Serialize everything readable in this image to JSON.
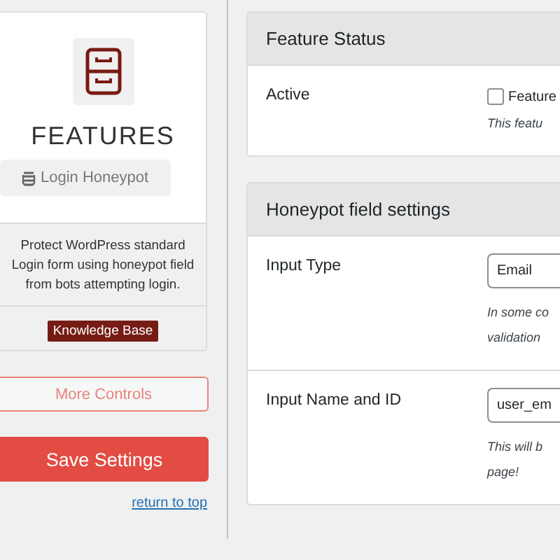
{
  "sidebar": {
    "title": "FEATURES",
    "feature_tag": "Login Honeypot",
    "description": "Protect WordPress standard Login form using honeypot field from bots attempting login.",
    "badge": "Knowledge Base",
    "more_button": "More Controls",
    "save_button": "Save Settings",
    "return_link": "return to top"
  },
  "panels": [
    {
      "title": "Feature Status",
      "rows": [
        {
          "label": "Active",
          "kind": "checkbox",
          "checked": false,
          "option": "Feature",
          "help": [
            "This featu"
          ]
        }
      ]
    },
    {
      "title": "Honeypot field settings",
      "rows": [
        {
          "label": "Input Type",
          "kind": "select",
          "value": "Email",
          "help": [
            "In some co",
            "validation"
          ]
        },
        {
          "label": "Input Name and ID",
          "kind": "text",
          "value": "user_em",
          "help": [
            "This will b",
            "page!"
          ]
        }
      ]
    }
  ]
}
